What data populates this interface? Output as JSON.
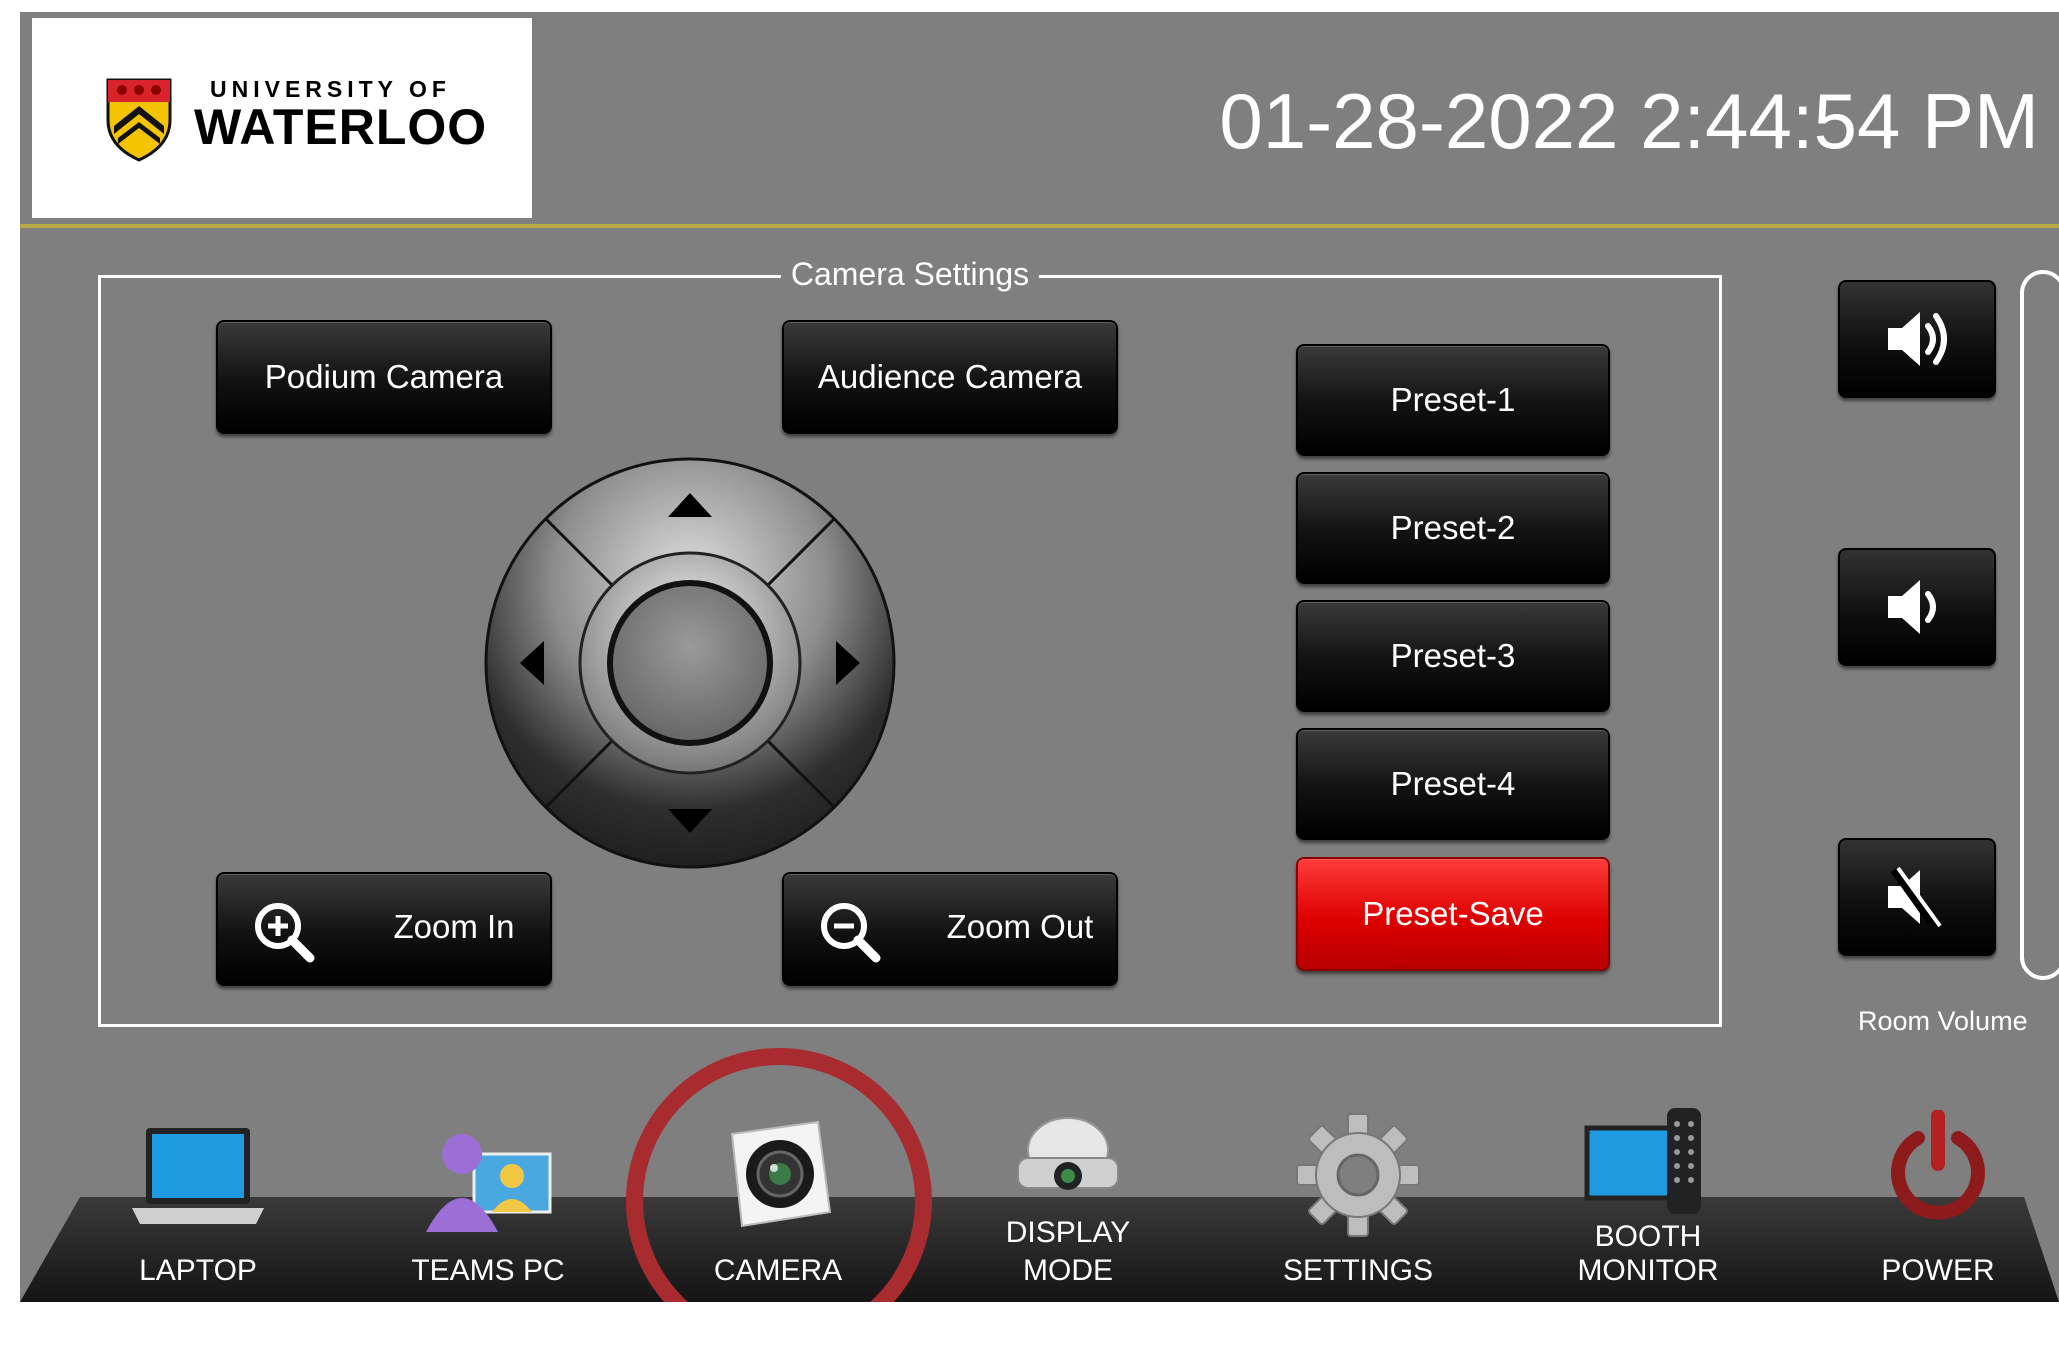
{
  "logo": {
    "line1": "UNIVERSITY OF",
    "line2": "WATERLOO"
  },
  "header": {
    "datetime": "01-28-2022 2:44:54 PM"
  },
  "camera_settings": {
    "title": "Camera Settings",
    "podium_camera": "Podium Camera",
    "audience_camera": "Audience Camera",
    "zoom_in": "Zoom In",
    "zoom_out": "Zoom Out",
    "presets": [
      "Preset-1",
      "Preset-2",
      "Preset-3",
      "Preset-4"
    ],
    "preset_save": "Preset-Save"
  },
  "volume": {
    "label": "Room Volume"
  },
  "nav": {
    "laptop": "LAPTOP",
    "teams_pc": "TEAMS PC",
    "camera": "CAMERA",
    "display_mode_1": "DISPLAY",
    "display_mode_2": "MODE",
    "settings": "SETTINGS",
    "booth_monitor_1": "BOOTH",
    "booth_monitor_2": "MONITOR",
    "power": "POWER"
  },
  "colors": {
    "background": "#7f7f7f",
    "header_rule": "#b8a843",
    "preset_save": "#dd0000",
    "highlight_circle": "#a82b30"
  }
}
